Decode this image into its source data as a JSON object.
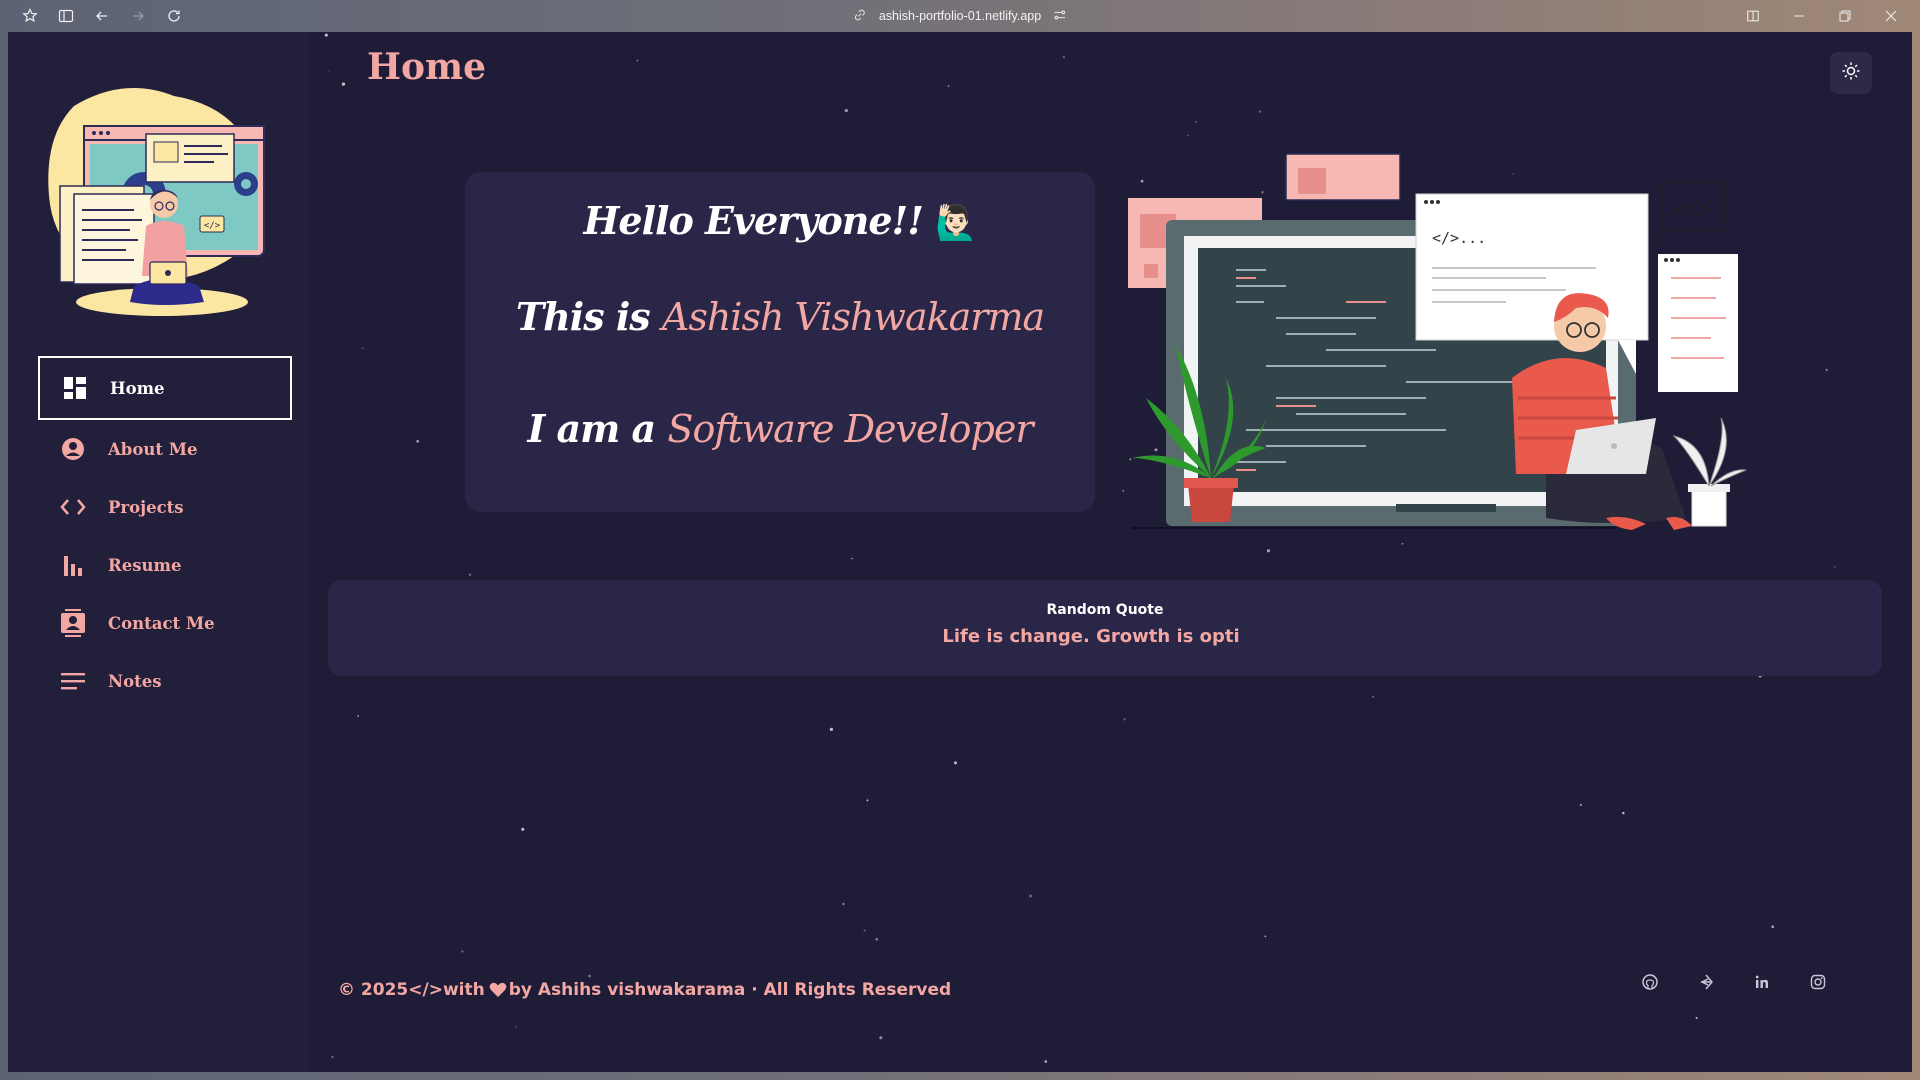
{
  "browser": {
    "url": "ashish-portfolio-01.netlify.app",
    "icons": [
      "extensions-icon",
      "sidebar-toggle-icon",
      "back-icon",
      "forward-icon",
      "reload-icon",
      "link-icon",
      "site-settings-icon",
      "split-view-icon",
      "minimize-icon",
      "restore-icon",
      "close-icon"
    ]
  },
  "sidebar": {
    "items": [
      {
        "label": "Home",
        "icon": "dashboard-icon",
        "active": true
      },
      {
        "label": "About Me",
        "icon": "user-circle-icon"
      },
      {
        "label": "Projects",
        "icon": "code-icon"
      },
      {
        "label": "Resume",
        "icon": "bar-chart-icon"
      },
      {
        "label": "Contact Me",
        "icon": "contact-card-icon"
      },
      {
        "label": "Notes",
        "icon": "notes-lines-icon"
      }
    ]
  },
  "header": {
    "title": "Home",
    "theme_icon": "sun-icon"
  },
  "hero": {
    "greeting": "Hello Everyone!!",
    "greeting_emoji": "🙋🏻‍♂️",
    "intro_prefix": "This is",
    "name": "Ashish Vishwakarma",
    "role_prefix": "I am a",
    "role": "Software Developer"
  },
  "quote": {
    "title": "Random Quote",
    "text": "Life is change. Growth is opti"
  },
  "footer": {
    "text_prefix": "© 2025",
    "code_symbol": "</>",
    "with": " with",
    "by_text": "by Ashihs vishwakarama · All Rights Reserved",
    "social": [
      "github-icon",
      "codechef-icon",
      "linkedin-icon",
      "instagram-icon"
    ]
  },
  "colors": {
    "accent": "#f2a7a3",
    "background": "#1f1c38",
    "card": "#2a2647",
    "sidebar": "#221f3b"
  }
}
